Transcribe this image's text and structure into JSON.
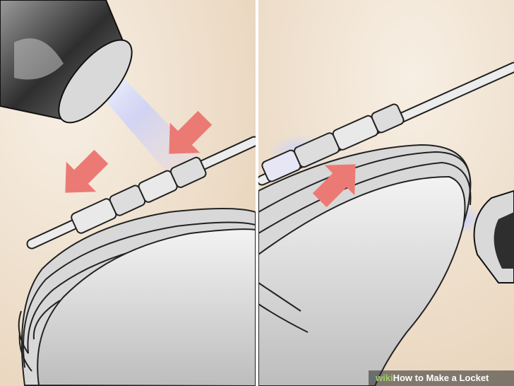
{
  "watermark": {
    "brand": "wiki",
    "title": "How to Make a Locket"
  },
  "colors": {
    "background": "#efe0cc",
    "metal": "#c8c8c8",
    "arrow": "#ec7a74",
    "flame": "#b9c4ff"
  },
  "icons": [
    "arrow-down-right-icon",
    "arrow-up-left-icon",
    "torch-icon",
    "locket-shell-icon",
    "hinge-pin-icon"
  ]
}
